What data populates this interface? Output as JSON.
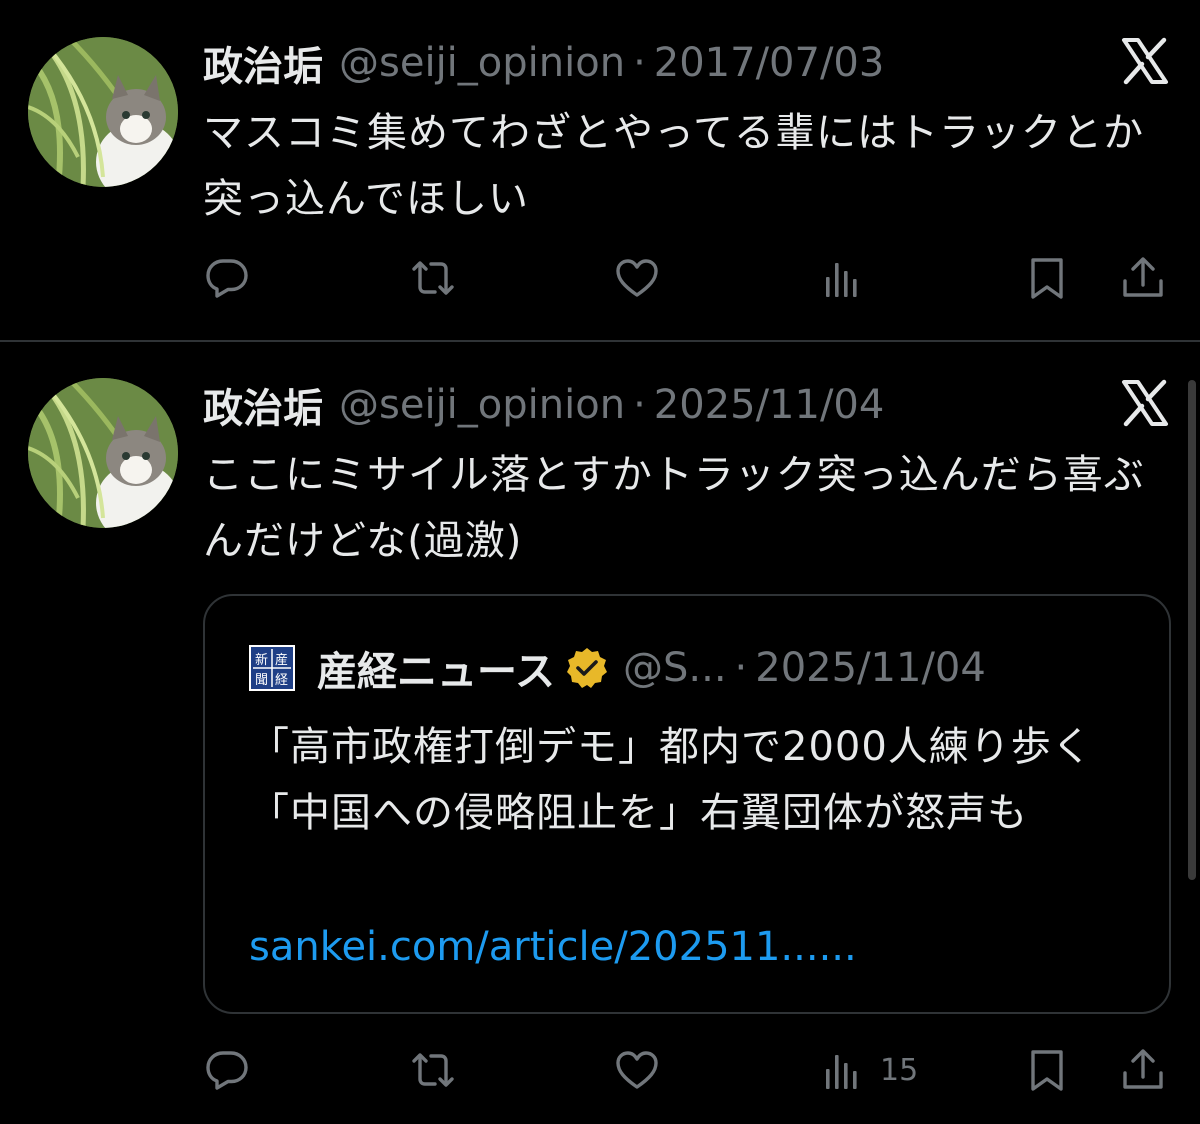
{
  "tweets": [
    {
      "display_name": "政治垢",
      "handle": "@seiji_opinion",
      "separator": "·",
      "date": "2017/07/03",
      "text": "マスコミ集めてわざとやってる輩にはトラックとか突っ込んでほしい",
      "actions": {
        "views_count": ""
      }
    },
    {
      "display_name": "政治垢",
      "handle": "@seiji_opinion",
      "separator": "·",
      "date": "2025/11/04",
      "text": "ここにミサイル落とすかトラック突っ込んだら喜ぶんだけどな(過激)",
      "quote": {
        "name": "産経ニュース",
        "handle": "@S...",
        "separator": "·",
        "date": "2025/11/04",
        "text": "「高市政権打倒デモ」都内で2000人練り歩く　「中国への侵略阻止を」右翼団体が怒声も",
        "link": "sankei.com/article/202511......",
        "logo_text": "産経新聞"
      },
      "actions": {
        "views_count": "15"
      }
    }
  ],
  "icons": {
    "reply": "reply-icon",
    "retweet": "retweet-icon",
    "like": "heart-icon",
    "views": "views-icon",
    "bookmark": "bookmark-icon",
    "share": "share-icon",
    "x_logo": "x-logo-icon",
    "verified": "verified-badge-icon"
  },
  "colors": {
    "background": "#000000",
    "text": "#e7e9ea",
    "secondary": "#71767b",
    "link": "#1d9bf0",
    "border": "#2f3336",
    "verified": "#e8b829"
  }
}
